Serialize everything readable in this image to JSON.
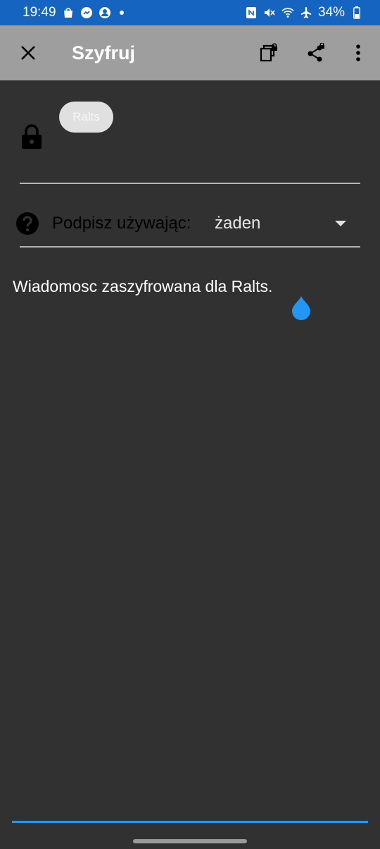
{
  "status_bar": {
    "time": "19:49",
    "battery": "34%",
    "icons_left": [
      "shopping-bag-icon",
      "messenger-icon",
      "account-icon",
      "notification-dot-icon"
    ],
    "icons_right": [
      "nfc-icon",
      "mute-icon",
      "wifi-icon",
      "airplane-mode-icon",
      "battery-icon"
    ]
  },
  "toolbar": {
    "title": "Szyfruj",
    "background": "#9e9e9e"
  },
  "recipients": {
    "chip_label": "Ralts"
  },
  "sign": {
    "label": "Podpisz używając:",
    "selected": "żaden"
  },
  "message": {
    "text": "Wiadomosc zaszyfrowana dla Ralts."
  },
  "colors": {
    "status_bar": "#1565c0",
    "background": "#313131",
    "accent": "#2196f3"
  }
}
